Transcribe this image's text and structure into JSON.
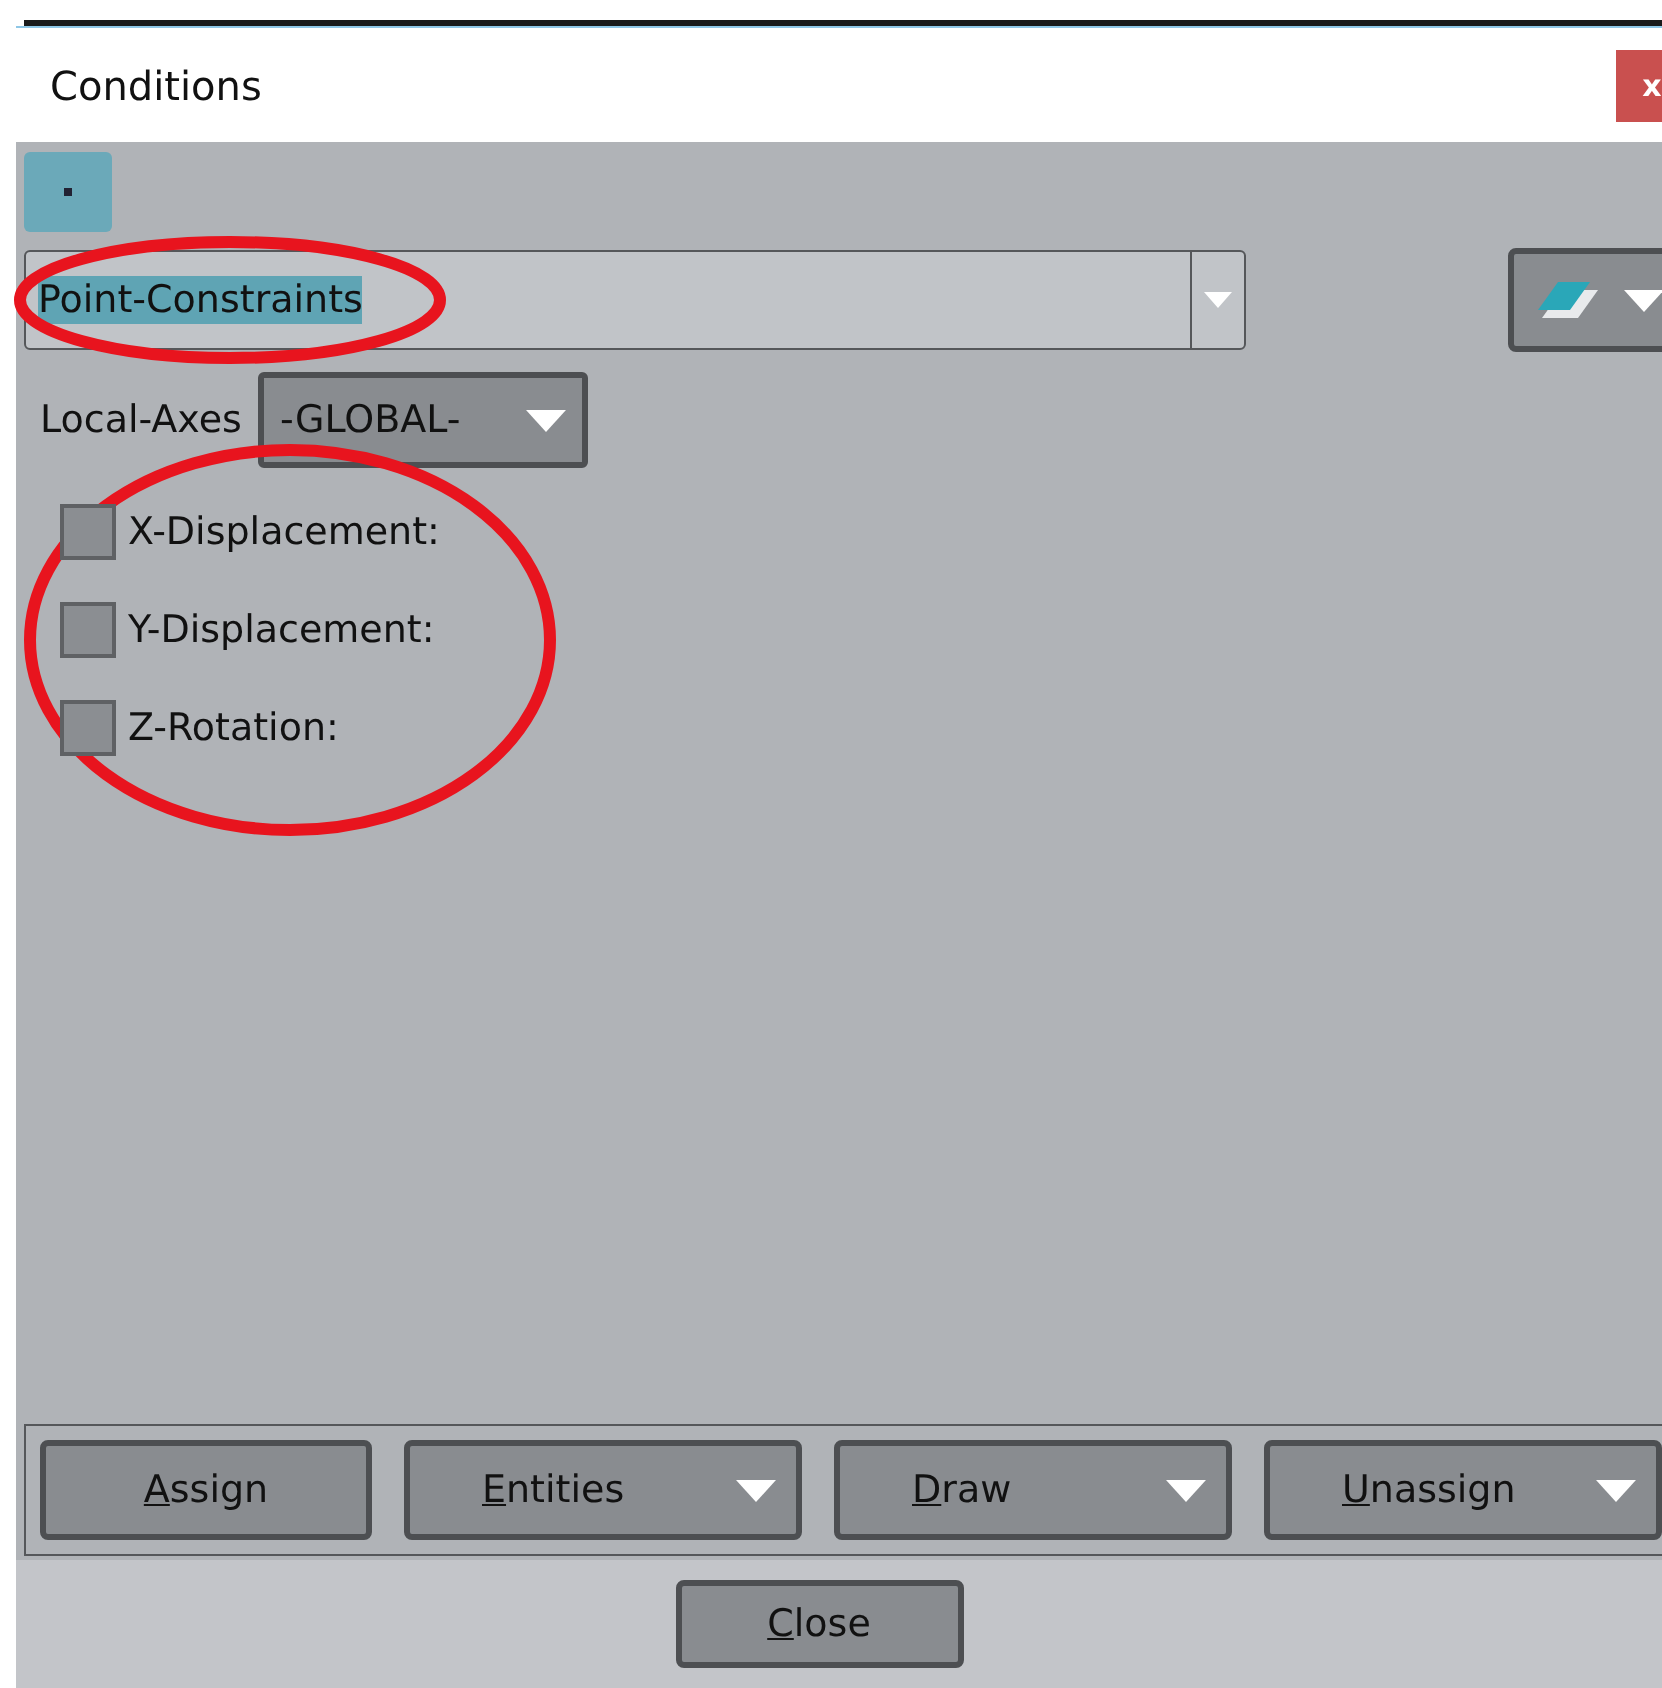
{
  "window": {
    "title": "Conditions",
    "close": "x"
  },
  "condition": {
    "value": "Point-Constraints",
    "highlighted": true
  },
  "local_axes": {
    "label": "Local-Axes",
    "value": "-GLOBAL-"
  },
  "constraints": {
    "highlighted": true,
    "items": [
      {
        "label": "X-Displacement:",
        "checked": false
      },
      {
        "label": "Y-Displacement:",
        "checked": false
      },
      {
        "label": "Z-Rotation:",
        "checked": false
      }
    ]
  },
  "actions": [
    {
      "accel": "A",
      "rest": "ssign",
      "kind": "button"
    },
    {
      "accel": "E",
      "rest": "ntities",
      "kind": "menu"
    },
    {
      "accel": "D",
      "rest": "raw",
      "kind": "menu"
    },
    {
      "accel": "U",
      "rest": "nassign",
      "kind": "menu"
    }
  ],
  "close_button": {
    "accel": "C",
    "rest": "lose"
  }
}
